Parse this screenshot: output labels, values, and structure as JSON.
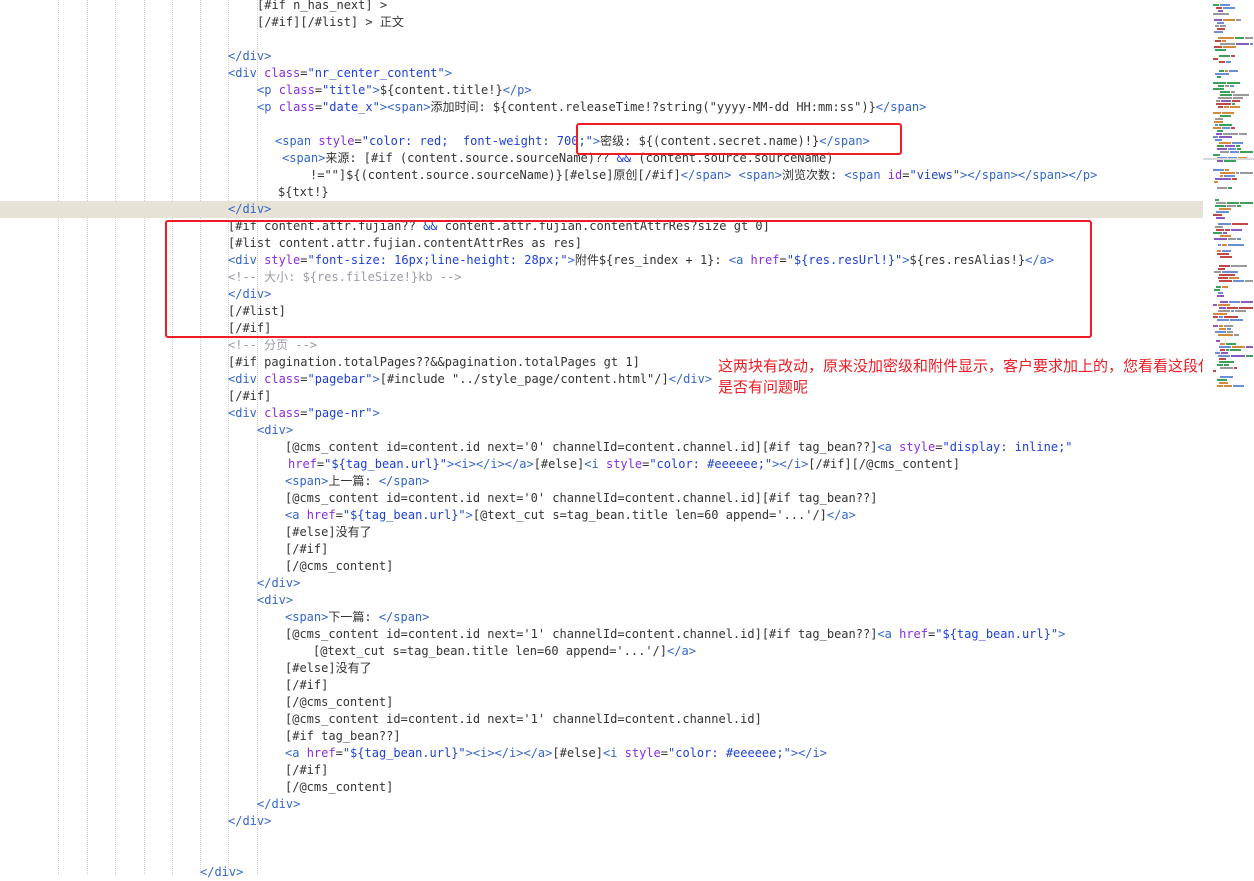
{
  "editor": {
    "lines": [
      [
        [
          "k",
          "[#if n_has_next] >"
        ]
      ],
      [
        [
          "k",
          "[/#if][/#list] > 正文"
        ]
      ],
      [
        [
          "k",
          ""
        ]
      ],
      [
        [
          "t",
          "</div>"
        ]
      ],
      [
        [
          "t",
          "<div "
        ],
        [
          "a",
          "class"
        ],
        [
          "k",
          "="
        ],
        [
          "s",
          "\"nr_center_content\""
        ],
        [
          "t",
          ">"
        ]
      ],
      [
        [
          "t",
          "<p "
        ],
        [
          "a",
          "class"
        ],
        [
          "k",
          "="
        ],
        [
          "s",
          "\"title\""
        ],
        [
          "t",
          ">"
        ],
        [
          "k",
          "${content.title!}"
        ],
        [
          "t",
          "</p>"
        ]
      ],
      [
        [
          "t",
          "<p "
        ],
        [
          "a",
          "class"
        ],
        [
          "k",
          "="
        ],
        [
          "s",
          "\"date_x\""
        ],
        [
          "t",
          ">"
        ],
        [
          "t",
          "<span>"
        ],
        [
          "k",
          "添加时间: ${content.releaseTime!?string(\"yyyy-MM-dd HH:mm:ss\")}"
        ],
        [
          "t",
          "</span>"
        ]
      ],
      [
        [
          "k",
          ""
        ]
      ],
      [
        [
          "t",
          "<span "
        ],
        [
          "a",
          "style"
        ],
        [
          "k",
          "="
        ],
        [
          "s",
          "\"color: red;  font-weight: 700;\""
        ],
        [
          "t",
          ">"
        ],
        [
          "k",
          "密级: ${(content.secret.name)!}"
        ],
        [
          "t",
          "</span>"
        ]
      ],
      [
        [
          "t",
          "<span>"
        ],
        [
          "k",
          "来源: [#if (content.source.sourceName)?? "
        ],
        [
          "s",
          "&&"
        ],
        [
          "k",
          " (content.source.sourceName)"
        ]
      ],
      [
        [
          "k",
          "!=\"\"]${(content.source.sourceName)}[#else]原创[/#if]"
        ],
        [
          "t",
          "</span>"
        ],
        [
          "k",
          " "
        ],
        [
          "t",
          "<span>"
        ],
        [
          "k",
          "浏览次数: "
        ],
        [
          "t",
          "<span "
        ],
        [
          "a",
          "id"
        ],
        [
          "k",
          "="
        ],
        [
          "s",
          "\"views\""
        ],
        [
          "t",
          ">"
        ],
        [
          "t",
          "</span>"
        ],
        [
          "t",
          "</span>"
        ],
        [
          "t",
          "</p>"
        ]
      ],
      [
        [
          "k",
          "${txt!}"
        ]
      ],
      [
        [
          "t",
          "</div>"
        ]
      ],
      [
        [
          "k",
          "[#if content.attr.fujian?? "
        ],
        [
          "s",
          "&&"
        ],
        [
          "k",
          " content.attr.fujian.contentAttrRes?size gt 0]"
        ]
      ],
      [
        [
          "k",
          "[#list content.attr.fujian.contentAttrRes as res]"
        ]
      ],
      [
        [
          "t",
          "<div "
        ],
        [
          "a",
          "style"
        ],
        [
          "k",
          "="
        ],
        [
          "s",
          "\"font-size: 16px;line-height: 28px;\""
        ],
        [
          "t",
          ">"
        ],
        [
          "k",
          "附件${res_index + 1}: "
        ],
        [
          "t",
          "<a "
        ],
        [
          "a",
          "href"
        ],
        [
          "k",
          "="
        ],
        [
          "s",
          "\"${res.resUrl!}\""
        ],
        [
          "t",
          ">"
        ],
        [
          "k",
          "${res.resAlias!}"
        ],
        [
          "t",
          "</a>"
        ]
      ],
      [
        [
          "cm",
          "<!-- 大小: ${res.fileSize!}kb -->"
        ]
      ],
      [
        [
          "t",
          "</div>"
        ]
      ],
      [
        [
          "k",
          "[/#list]"
        ]
      ],
      [
        [
          "k",
          "[/#if]"
        ]
      ],
      [
        [
          "cm",
          "<!-- 分页 -->"
        ]
      ],
      [
        [
          "k",
          "[#if pagination.totalPages??&&pagination.totalPages gt 1]"
        ]
      ],
      [
        [
          "t",
          "<div "
        ],
        [
          "a",
          "class"
        ],
        [
          "k",
          "="
        ],
        [
          "s",
          "\"pagebar\""
        ],
        [
          "t",
          ">"
        ],
        [
          "k",
          "[#include \"../style_page/content.html\"/]"
        ],
        [
          "t",
          "</div>"
        ]
      ],
      [
        [
          "k",
          "[/#if]"
        ]
      ],
      [
        [
          "t",
          "<div "
        ],
        [
          "a",
          "class"
        ],
        [
          "k",
          "="
        ],
        [
          "s",
          "\"page-nr\""
        ],
        [
          "t",
          ">"
        ]
      ],
      [
        [
          "t",
          "<div>"
        ]
      ],
      [
        [
          "k",
          "[@cms_content id=content.id next='0' channelId=content.channel.id][#if tag_bean??]"
        ],
        [
          "t",
          "<a "
        ],
        [
          "a",
          "style"
        ],
        [
          "k",
          "="
        ],
        [
          "s",
          "\"display: inline;\""
        ]
      ],
      [
        [
          "a",
          "href"
        ],
        [
          "k",
          "="
        ],
        [
          "s",
          "\"${tag_bean.url}\""
        ],
        [
          "t",
          ">"
        ],
        [
          "t",
          "<i>"
        ],
        [
          "t",
          "</i>"
        ],
        [
          "t",
          "</a>"
        ],
        [
          "k",
          "[#else]"
        ],
        [
          "t",
          "<i "
        ],
        [
          "a",
          "style"
        ],
        [
          "k",
          "="
        ],
        [
          "s",
          "\"color: #eeeeee;\""
        ],
        [
          "t",
          ">"
        ],
        [
          "t",
          "</i>"
        ],
        [
          "k",
          "[/#if][/@cms_content]"
        ]
      ],
      [
        [
          "t",
          "<span>"
        ],
        [
          "k",
          "上一篇: "
        ],
        [
          "t",
          "</span>"
        ]
      ],
      [
        [
          "k",
          "[@cms_content id=content.id next='0' channelId=content.channel.id][#if tag_bean??]"
        ]
      ],
      [
        [
          "t",
          "<a "
        ],
        [
          "a",
          "href"
        ],
        [
          "k",
          "="
        ],
        [
          "s",
          "\"${tag_bean.url}\""
        ],
        [
          "t",
          ">"
        ],
        [
          "k",
          "[@text_cut s=tag_bean.title len=60 append='...'/]"
        ],
        [
          "t",
          "</a>"
        ]
      ],
      [
        [
          "k",
          "[#else]没有了"
        ]
      ],
      [
        [
          "k",
          "[/#if]"
        ]
      ],
      [
        [
          "k",
          "[/@cms_content]"
        ]
      ],
      [
        [
          "t",
          "</div>"
        ]
      ],
      [
        [
          "t",
          "<div>"
        ]
      ],
      [
        [
          "t",
          "<span>"
        ],
        [
          "k",
          "下一篇: "
        ],
        [
          "t",
          "</span>"
        ]
      ],
      [
        [
          "k",
          "[@cms_content id=content.id next='1' channelId=content.channel.id][#if tag_bean??]"
        ],
        [
          "t",
          "<a "
        ],
        [
          "a",
          "href"
        ],
        [
          "k",
          "="
        ],
        [
          "s",
          "\"${tag_bean.url}\""
        ],
        [
          "t",
          ">"
        ]
      ],
      [
        [
          "k",
          "[@text_cut s=tag_bean.title len=60 append='...'/]"
        ],
        [
          "t",
          "</a>"
        ]
      ],
      [
        [
          "k",
          "[#else]没有了"
        ]
      ],
      [
        [
          "k",
          "[/#if]"
        ]
      ],
      [
        [
          "k",
          "[/@cms_content]"
        ]
      ],
      [
        [
          "k",
          "[@cms_content id=content.id next='1' channelId=content.channel.id]"
        ]
      ],
      [
        [
          "k",
          "[#if tag_bean??]"
        ]
      ],
      [
        [
          "t",
          "<a "
        ],
        [
          "a",
          "href"
        ],
        [
          "k",
          "="
        ],
        [
          "s",
          "\"${tag_bean.url}\""
        ],
        [
          "t",
          ">"
        ],
        [
          "t",
          "<i>"
        ],
        [
          "t",
          "</i>"
        ],
        [
          "t",
          "</a>"
        ],
        [
          "k",
          "[#else]"
        ],
        [
          "t",
          "<i "
        ],
        [
          "a",
          "style"
        ],
        [
          "k",
          "="
        ],
        [
          "s",
          "\"color: #eeeeee;\""
        ],
        [
          "t",
          ">"
        ],
        [
          "t",
          "</i>"
        ]
      ],
      [
        [
          "k",
          "[/#if]"
        ]
      ],
      [
        [
          "k",
          "[/@cms_content]"
        ]
      ],
      [
        [
          "t",
          "</div>"
        ]
      ],
      [
        [
          "t",
          "</div>"
        ]
      ],
      [
        [
          "k",
          ""
        ]
      ],
      [
        [
          "k",
          ""
        ]
      ],
      [
        [
          "t",
          "</div>"
        ]
      ]
    ]
  },
  "annotation": {
    "note": "这两块有改动，原来没加密级和附件显示，客户要求加上的，您看看这段代码是否有问题呢"
  },
  "colors": {
    "tag": "#3366cc",
    "attr": "#8a2be2",
    "string": "#1e40d6",
    "comment": "#9a9aa6",
    "text": "#333333",
    "highlight_line": "#e6e3d6",
    "annotation_red": "#ee1c24"
  }
}
